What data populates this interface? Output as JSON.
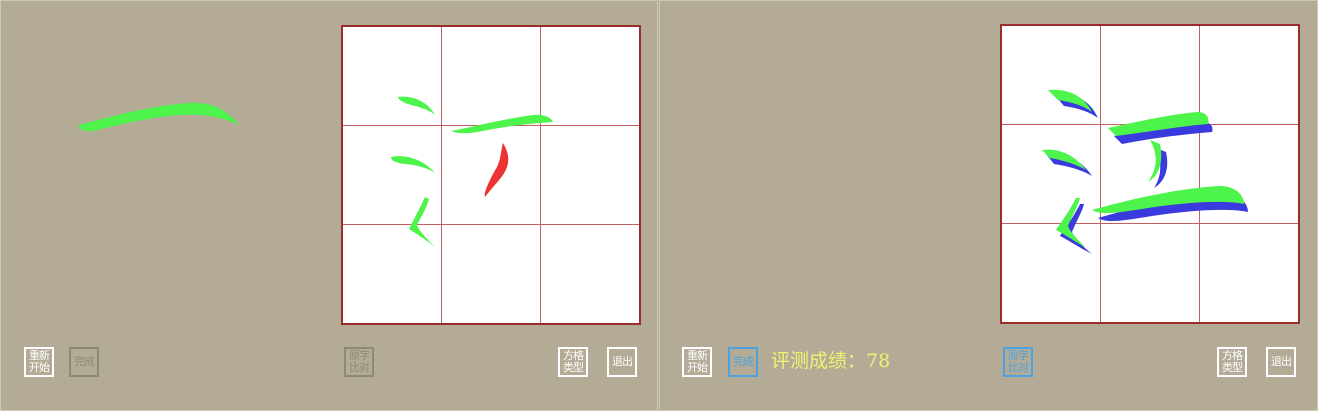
{
  "left_panel": {
    "preview_stroke": "horizontal",
    "buttons": {
      "restart": [
        "重新",
        "开始"
      ],
      "done": [
        "完成"
      ],
      "compare": [
        "原字",
        "比对"
      ],
      "grid_type": [
        "方格",
        "类型"
      ],
      "exit": [
        "退出"
      ]
    }
  },
  "right_panel": {
    "score_label": "评测成绩：",
    "score_value": "78",
    "buttons": {
      "restart": [
        "重新",
        "开始"
      ],
      "done": [
        "完成"
      ],
      "compare": [
        "原字",
        "比对"
      ],
      "grid_type": [
        "方格",
        "类型"
      ],
      "exit": [
        "退出"
      ]
    }
  },
  "colors": {
    "background": "#b4ab97",
    "grid_border": "#9b2d2d",
    "stroke_user": "#4cf44c",
    "stroke_wrong": "#ee3333",
    "stroke_reference": "#3a3adf",
    "score_text": "#f3f170",
    "button_active_blue": "#4aa3e0"
  }
}
